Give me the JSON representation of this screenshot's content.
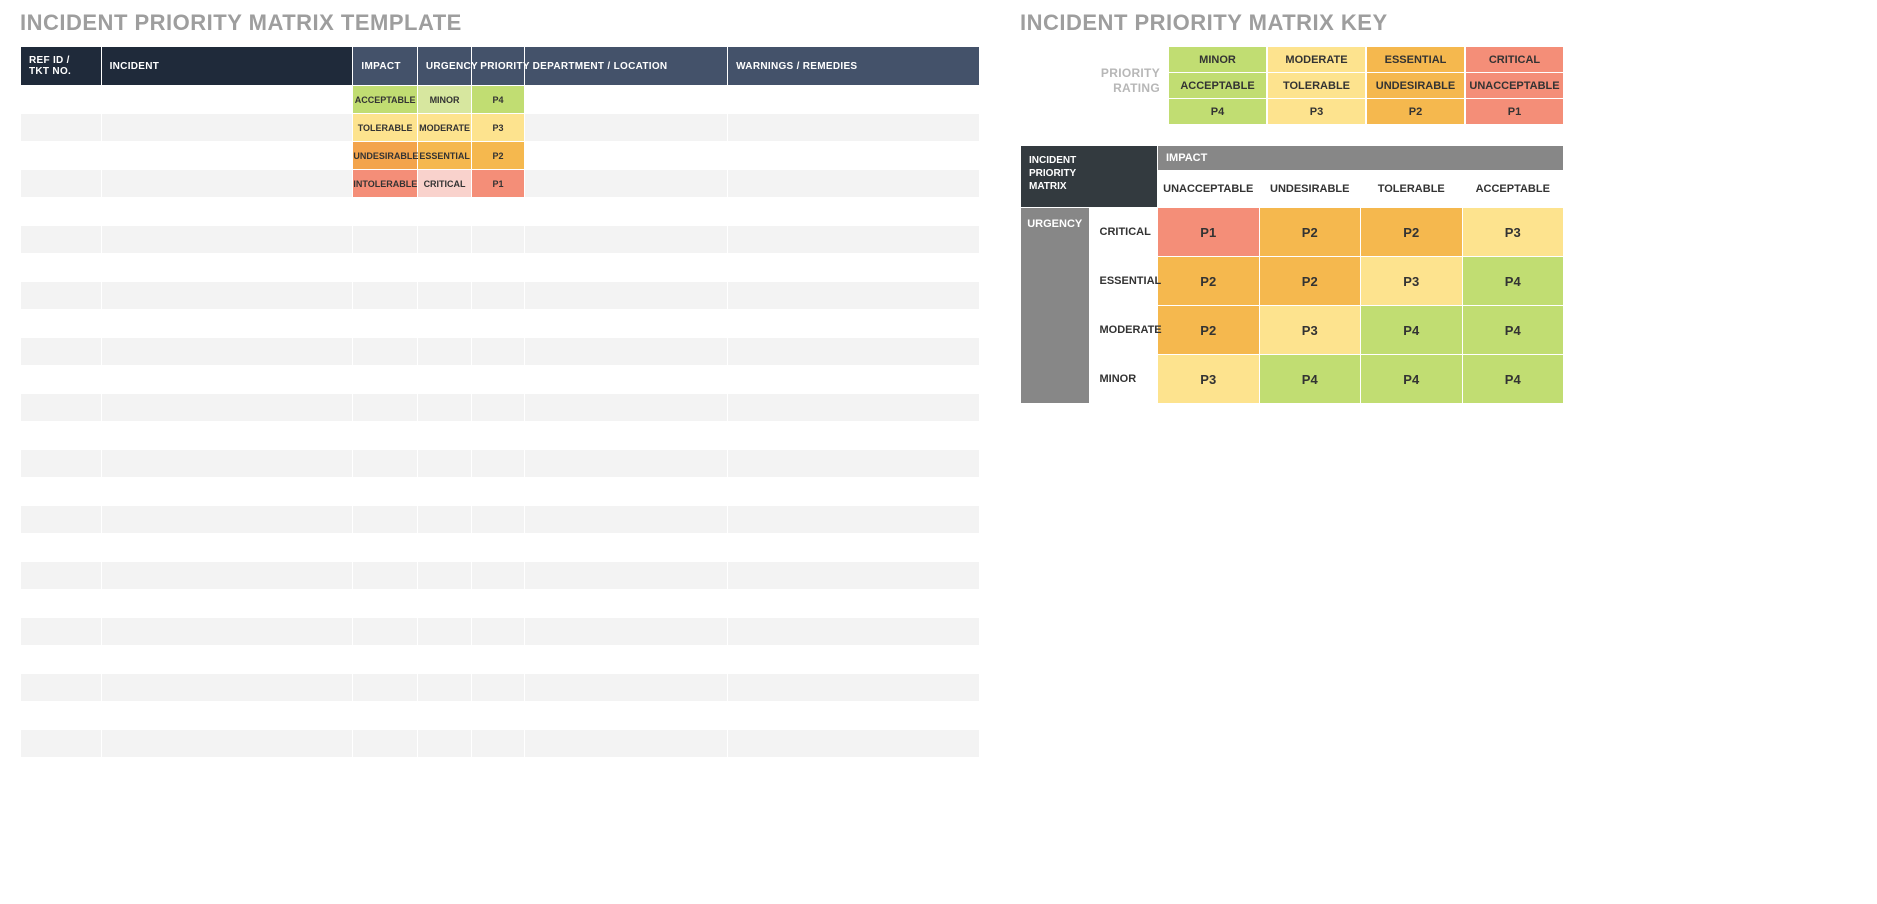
{
  "left": {
    "title": "INCIDENT PRIORITY MATRIX TEMPLATE",
    "headers": {
      "ref": "REF ID / TKT NO.",
      "incident": "INCIDENT",
      "impact": "IMPACT",
      "urgency": "URGENCY",
      "priority": "PRIORITY",
      "dept": "DEPARTMENT / LOCATION",
      "warn": "WARNINGS / REMEDIES"
    },
    "rows": [
      {
        "impact": "ACCEPTABLE",
        "urgency": "MINOR",
        "priority": "P4",
        "impCls": "c-green",
        "urgCls": "c-lgreen",
        "priCls": "c-green"
      },
      {
        "impact": "TOLERABLE",
        "urgency": "MODERATE",
        "priority": "P3",
        "impCls": "c-yellow",
        "urgCls": "c-yellow",
        "priCls": "c-yellow"
      },
      {
        "impact": "UNDESIRABLE",
        "urgency": "ESSENTIAL",
        "priority": "P2",
        "impCls": "c-dorange",
        "urgCls": "c-orange",
        "priCls": "c-orange"
      },
      {
        "impact": "INTOLERABLE",
        "urgency": "CRITICAL",
        "priority": "P1",
        "impCls": "c-salmon",
        "urgCls": "c-pink",
        "priCls": "c-salmon"
      }
    ],
    "blankRows": 21
  },
  "key": {
    "title": "INCIDENT PRIORITY MATRIX KEY",
    "ratingLabel1": "PRIORITY",
    "ratingLabel2": "RATING",
    "ratingCols": [
      {
        "a": "MINOR",
        "b": "ACCEPTABLE",
        "c": "P4",
        "cls": "c-green"
      },
      {
        "a": "MODERATE",
        "b": "TOLERABLE",
        "c": "P3",
        "cls": "c-yellow"
      },
      {
        "a": "ESSENTIAL",
        "b": "UNDESIRABLE",
        "c": "P2",
        "cls": "c-orange"
      },
      {
        "a": "CRITICAL",
        "b": "UNACCEPTABLE",
        "c": "P1",
        "cls": "c-salmon"
      }
    ],
    "matrix": {
      "corner1": "INCIDENT",
      "corner2": "PRIORITY",
      "corner3": "MATRIX",
      "impactHdr": "IMPACT",
      "impactCols": [
        "UNACCEPTABLE",
        "UNDESIRABLE",
        "TOLERABLE",
        "ACCEPTABLE"
      ],
      "urgencyHdr": "URGENCY",
      "rows": [
        {
          "label": "CRITICAL",
          "cells": [
            {
              "v": "P1",
              "cls": "c-salmon"
            },
            {
              "v": "P2",
              "cls": "c-orange"
            },
            {
              "v": "P2",
              "cls": "c-orange"
            },
            {
              "v": "P3",
              "cls": "c-yellow"
            }
          ]
        },
        {
          "label": "ESSENTIAL",
          "cells": [
            {
              "v": "P2",
              "cls": "c-orange"
            },
            {
              "v": "P2",
              "cls": "c-orange"
            },
            {
              "v": "P3",
              "cls": "c-yellow"
            },
            {
              "v": "P4",
              "cls": "c-green"
            }
          ]
        },
        {
          "label": "MODERATE",
          "cells": [
            {
              "v": "P2",
              "cls": "c-orange"
            },
            {
              "v": "P3",
              "cls": "c-yellow"
            },
            {
              "v": "P4",
              "cls": "c-green"
            },
            {
              "v": "P4",
              "cls": "c-green"
            }
          ]
        },
        {
          "label": "MINOR",
          "cells": [
            {
              "v": "P3",
              "cls": "c-yellow"
            },
            {
              "v": "P4",
              "cls": "c-green"
            },
            {
              "v": "P4",
              "cls": "c-green"
            },
            {
              "v": "P4",
              "cls": "c-green"
            }
          ]
        }
      ]
    }
  }
}
